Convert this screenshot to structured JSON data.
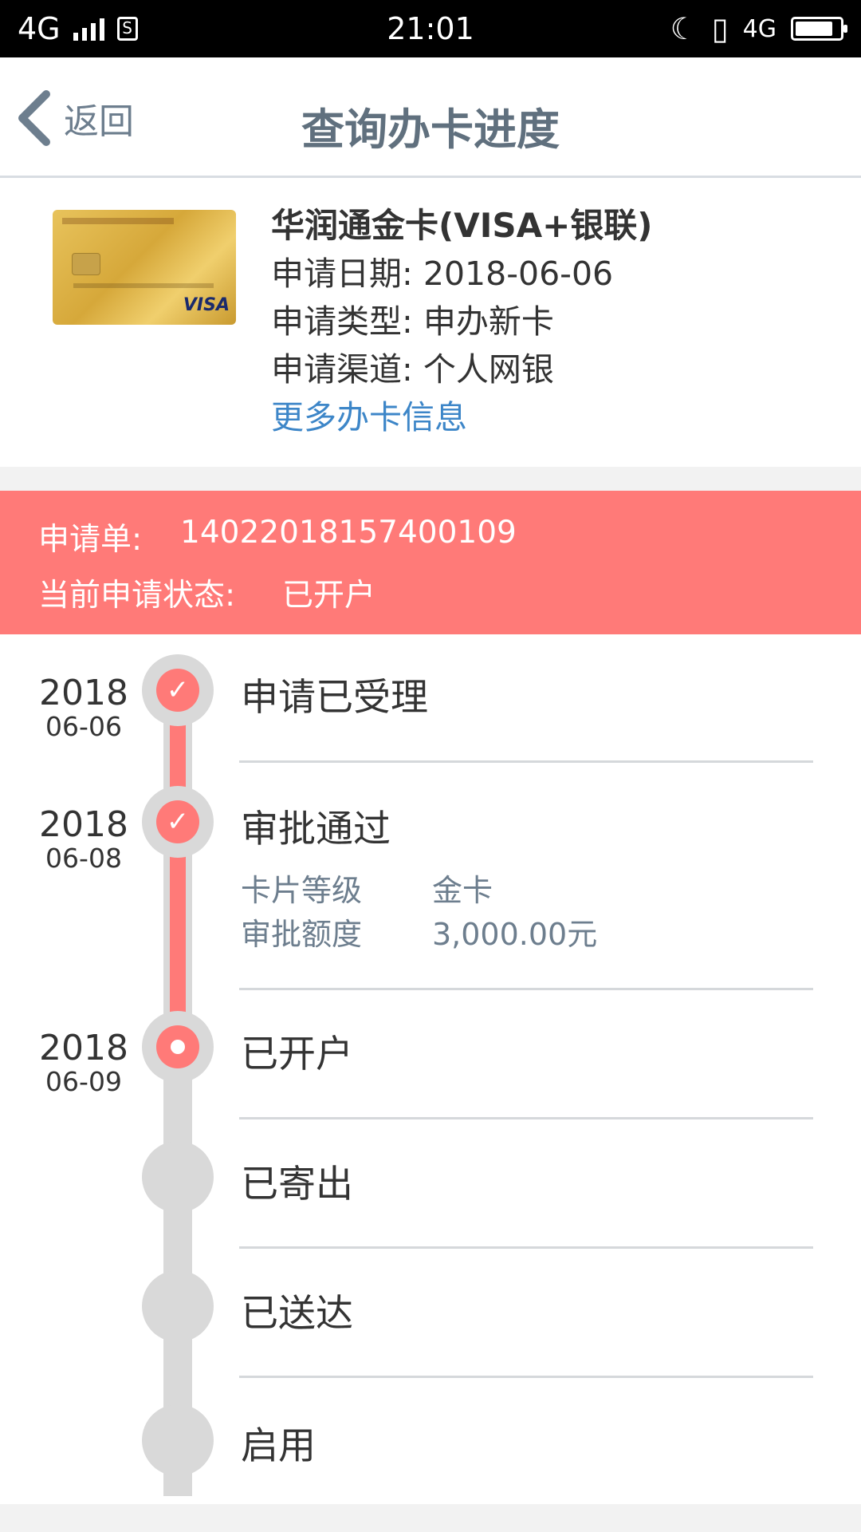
{
  "status_bar": {
    "network": "4G",
    "time": "21:01",
    "network_right": "4G",
    "battery_level": 0.85
  },
  "header": {
    "back_label": "返回",
    "title": "查询办卡进度"
  },
  "card": {
    "name": "华润通金卡(VISA+银联)",
    "apply_date_label": "申请日期:",
    "apply_date": "2018-06-06",
    "apply_type_label": "申请类型:",
    "apply_type": "申办新卡",
    "channel_label": "申请渠道:",
    "channel": "个人网银",
    "more_link": "更多办卡信息",
    "card_brand_mark": "VISA"
  },
  "banner": {
    "order_label": "申请单:",
    "order_no": "14022018157400109",
    "status_label": "当前申请状态:",
    "status": "已开户"
  },
  "timeline": [
    {
      "year": "2018",
      "date": "06-06",
      "title": "申请已受理",
      "state": "done"
    },
    {
      "year": "2018",
      "date": "06-08",
      "title": "审批通过",
      "state": "done",
      "details": [
        {
          "label": "卡片等级",
          "value": "金卡"
        },
        {
          "label": "审批额度",
          "value": "3,000.00元"
        }
      ]
    },
    {
      "year": "2018",
      "date": "06-09",
      "title": "已开户",
      "state": "current"
    },
    {
      "year": "",
      "date": "",
      "title": "已寄出",
      "state": "pending"
    },
    {
      "year": "",
      "date": "",
      "title": "已送达",
      "state": "pending"
    },
    {
      "year": "",
      "date": "",
      "title": "启用",
      "state": "pending"
    }
  ],
  "colors": {
    "accent": "#ff7a78",
    "link": "#3d86c8",
    "muted": "#6d7e8e",
    "track": "#d9d9d9"
  },
  "icons": {
    "back": "chevron-left-icon",
    "done": "check-icon",
    "current": "dot-icon"
  }
}
